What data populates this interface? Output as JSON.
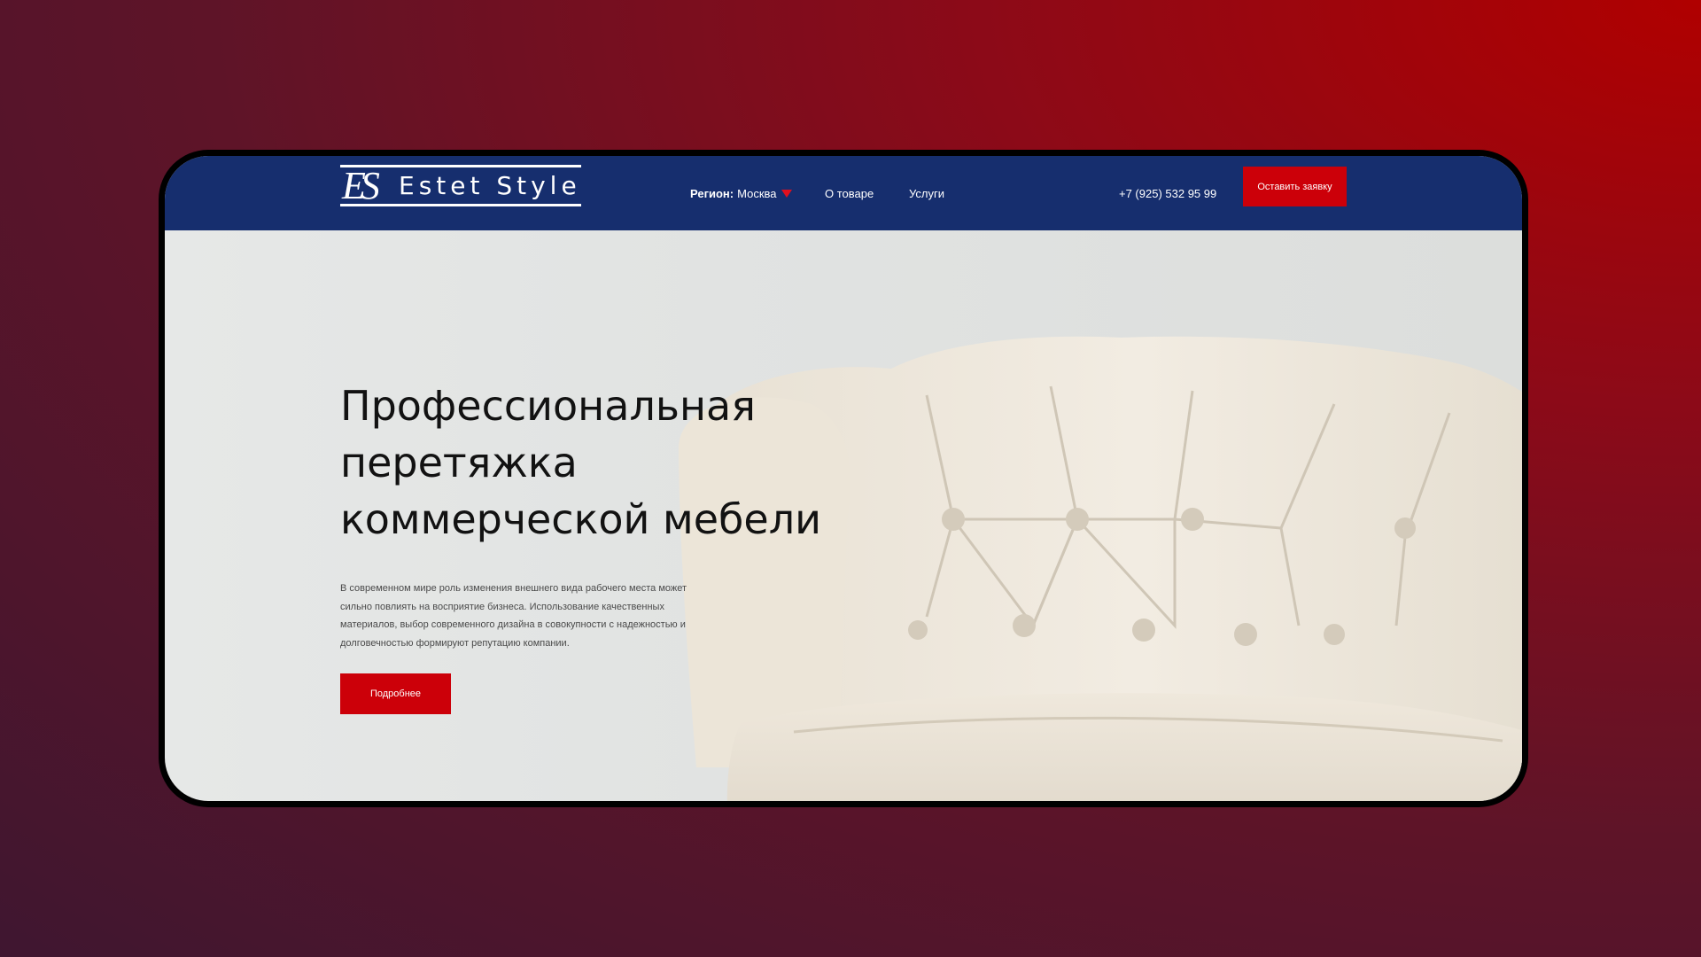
{
  "header": {
    "logo_mark": "ES",
    "logo_text": "Estet Style",
    "region_label": "Регион:",
    "region_value": "Москва",
    "nav_about": "О товаре",
    "nav_services": "Услуги",
    "phone": "+7 (925) 532 95 99",
    "cta_label": "Оставить заявку"
  },
  "hero": {
    "headline_lines": [
      "Профессиональная",
      "перетяжка",
      "коммерческой мебели"
    ],
    "description": "В современном мире роль изменения внешнего вида рабочего места может сильно повлиять на восприятие бизнеса. Использование качественных материалов, выбор современного дизайна в совокупности с надежностью и долговечностью формируют репутацию компании.",
    "more_label": "Подробнее"
  },
  "colors": {
    "header_bg": "#162e6e",
    "accent": "#cc0009"
  }
}
